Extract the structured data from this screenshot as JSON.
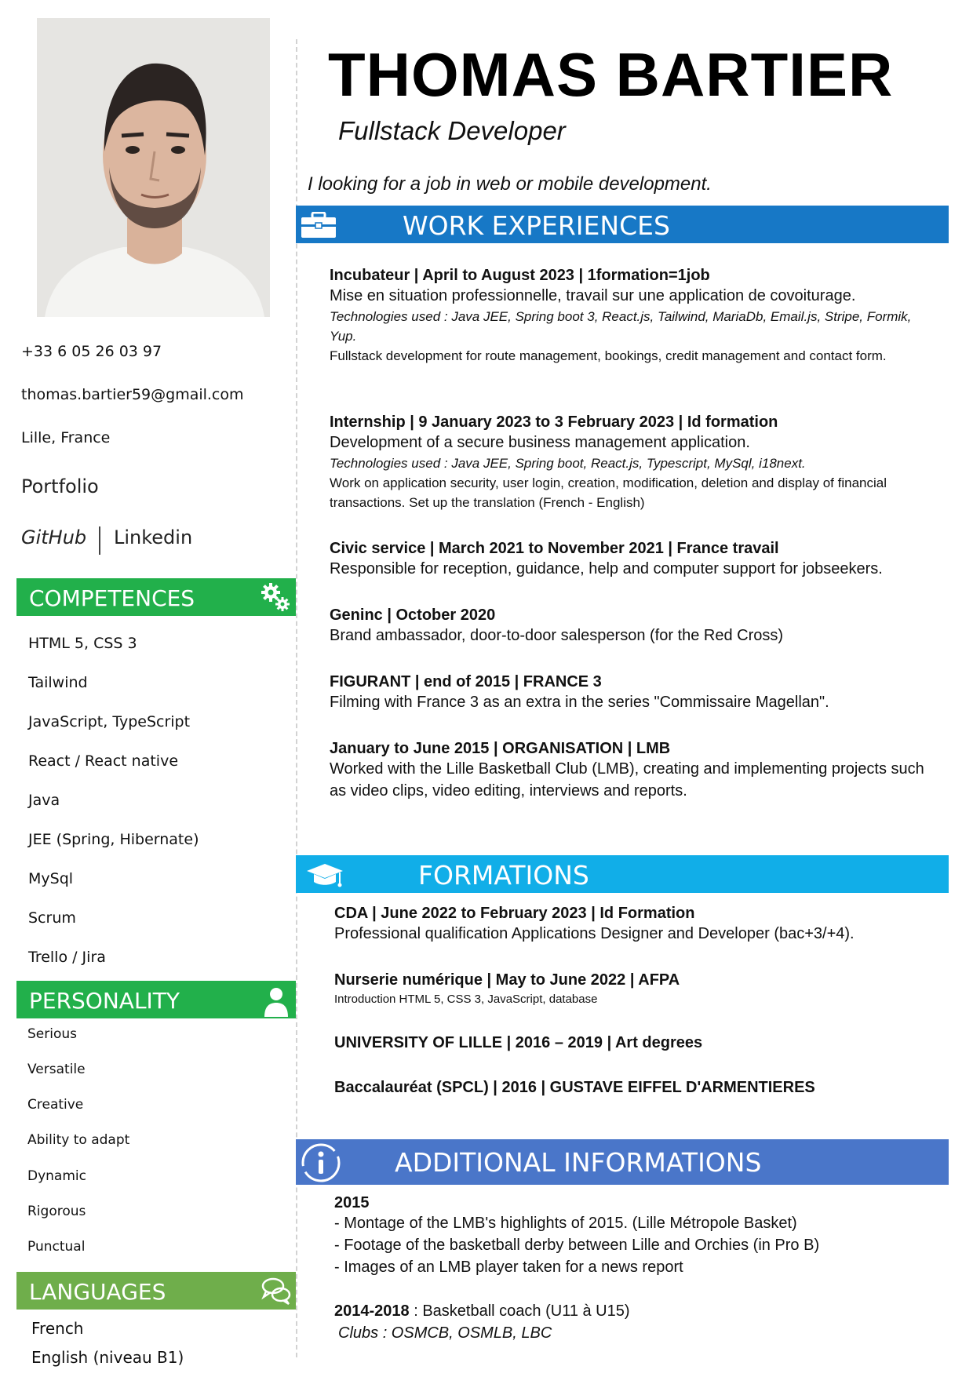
{
  "header": {
    "name": "THOMAS BARTIER",
    "job_title": "Fullstack Developer",
    "objective": "I looking for a job in web or mobile development."
  },
  "contact": {
    "phone": "+33 6 05 26 03 97",
    "email": "thomas.bartier59@gmail.com",
    "location": "Lille, France",
    "portfolio": "Portfolio",
    "github": "GitHub",
    "linkedin": "Linkedin"
  },
  "competences": {
    "title": "COMPETENCES",
    "items": [
      "HTML 5, CSS 3",
      "Tailwind",
      "JavaScript, TypeScript",
      "React / React native",
      "Java",
      "JEE (Spring, Hibernate)",
      "MySql",
      "Scrum",
      "Trello / Jira"
    ]
  },
  "personality": {
    "title": "PERSONALITY",
    "items": [
      "Serious",
      "Versatile",
      "Creative",
      "Ability to adapt",
      "Dynamic",
      "Rigorous",
      "Punctual"
    ]
  },
  "languages": {
    "title": "LANGUAGES",
    "items": [
      "French",
      "English (niveau B1)"
    ]
  },
  "work": {
    "title": "WORK EXPERIENCES",
    "entries": [
      {
        "title": "Incubateur | April to August 2023 | 1formation=1job",
        "desc": "Mise en situation professionnelle, travail sur une application de covoiturage.",
        "tech": "Technologies used : Java JEE, Spring boot 3, React.js, Tailwind, MariaDb, Email.js, Stripe, Formik, Yup.",
        "detail": "Fullstack development for route management, bookings, credit management and contact form."
      },
      {
        "title": "Internship | 9 January 2023 to 3 February 2023 | Id formation",
        "desc": "Development of a secure business management application.",
        "tech": "Technologies used : Java JEE, Spring boot, React.js, Typescript, MySql, i18next.",
        "detail": "Work on application security, user login, creation, modification, deletion and display of financial transactions. Set up the translation (French - English)"
      },
      {
        "title": "Civic service  | March 2021 to November 2021 | France travail",
        "desc": "Responsible for reception, guidance, help and computer support for jobseekers."
      },
      {
        "title": "Geninc | October 2020",
        "desc": "Brand ambassador, door-to-door salesperson (for the Red Cross)"
      },
      {
        "title": "FIGURANT | end of 2015 | FRANCE 3",
        "desc": "Filming with France 3 as an extra in the series \"Commissaire Magellan\"."
      },
      {
        "title": "January to June 2015 | ORGANISATION | LMB",
        "desc": "Worked with the Lille Basketball Club (LMB), creating and implementing projects such as video clips, video editing, interviews and reports."
      }
    ]
  },
  "formations": {
    "title": "FORMATIONS",
    "entries": [
      {
        "title": "CDA | June 2022 to February 2023 | Id Formation",
        "desc": "Professional qualification Applications Designer and Developer (bac+3/+4)."
      },
      {
        "title": "Nurserie numérique | May to June 2022 | AFPA",
        "desc": "Introduction HTML 5, CSS 3, JavaScript, database"
      },
      {
        "title": "UNIVERSITY OF LILLE | 2016 – 2019 | Art degrees"
      },
      {
        "title": "Baccalauréat (SPCL) | 2016 | GUSTAVE EIFFEL D'ARMENTIERES"
      }
    ]
  },
  "additional": {
    "title": "ADDITIONAL INFORMATIONS",
    "year": "2015",
    "lines": [
      "- Montage of the LMB's highlights of 2015. (Lille Métropole Basket)",
      "- Footage of the basketball derby between Lille and Orchies (in Pro B)",
      "- Images of an LMB player taken for a news report"
    ],
    "coach_years": "2014-2018",
    "coach_text": " : Basketball coach (U11 à U15)",
    "clubs": "Clubs : OSMCB, OSMLB, LBC"
  },
  "colors": {
    "green_header": "#22b04b",
    "languages_header": "#6fae4b",
    "work_header": "#1778c6",
    "formations_header": "#11aee8",
    "additional_header": "#4a76c9"
  },
  "icons": [
    "gears-icon",
    "person-icon",
    "chat-bubbles-icon",
    "briefcase-icon",
    "graduation-cap-icon",
    "info-icon"
  ]
}
